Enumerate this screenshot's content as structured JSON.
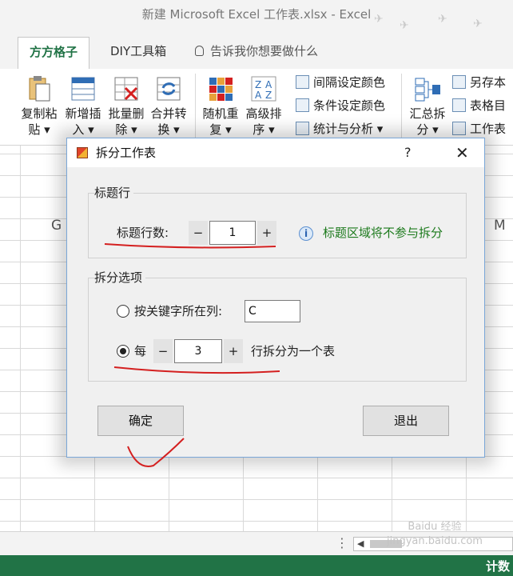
{
  "window": {
    "title": "新建 Microsoft Excel 工作表.xlsx - Excel"
  },
  "ribbon": {
    "tabs": [
      {
        "label": "方方格子",
        "active": true
      },
      {
        "label": "DIY工具箱",
        "active": false
      }
    ],
    "tell_me": "告诉我你想要做什么",
    "buttons": {
      "copy_paste": [
        "复制粘",
        "贴"
      ],
      "insert": [
        "新增插",
        "入"
      ],
      "delete": [
        "批量删",
        "除"
      ],
      "merge": [
        "合并转",
        "换"
      ],
      "random": [
        "随机重",
        "复"
      ],
      "sort": [
        "高级排",
        "序"
      ],
      "summary": [
        "汇总拆",
        "分"
      ]
    },
    "rows": {
      "interval_color": "间隔设定颜色",
      "condition_color": "条件设定颜色",
      "stats": "统计与分析",
      "save_as": "另存本",
      "table_dir": "表格目",
      "worksheet": "工作表"
    }
  },
  "grid": {
    "col_left": "G",
    "col_right": "M"
  },
  "status": {
    "right_text": "计数"
  },
  "watermark": {
    "line1": "Baidu 经验",
    "line2": "jingyan.baidu.com"
  },
  "dialog": {
    "title": "拆分工作表",
    "help": "?",
    "close": "✕",
    "title_row_group": {
      "caption": "标题行",
      "label": "标题行数:",
      "value": "1",
      "minus": "−",
      "plus": "+",
      "hint": "标题区域将不参与拆分"
    },
    "split_group": {
      "caption": "拆分选项",
      "option_column_label": "按关键字所在列:",
      "column_value": "C",
      "option_every_prefix": "每",
      "every_value": "3",
      "minus": "−",
      "plus": "+",
      "option_every_suffix": "行拆分为一个表",
      "selected": "every"
    },
    "ok_label": "确定",
    "exit_label": "退出"
  },
  "colors": {
    "excel_green": "#217346",
    "hint_green": "#1c7a1c",
    "annotation_red": "#d42020",
    "dialog_border": "#7aa7d8"
  }
}
